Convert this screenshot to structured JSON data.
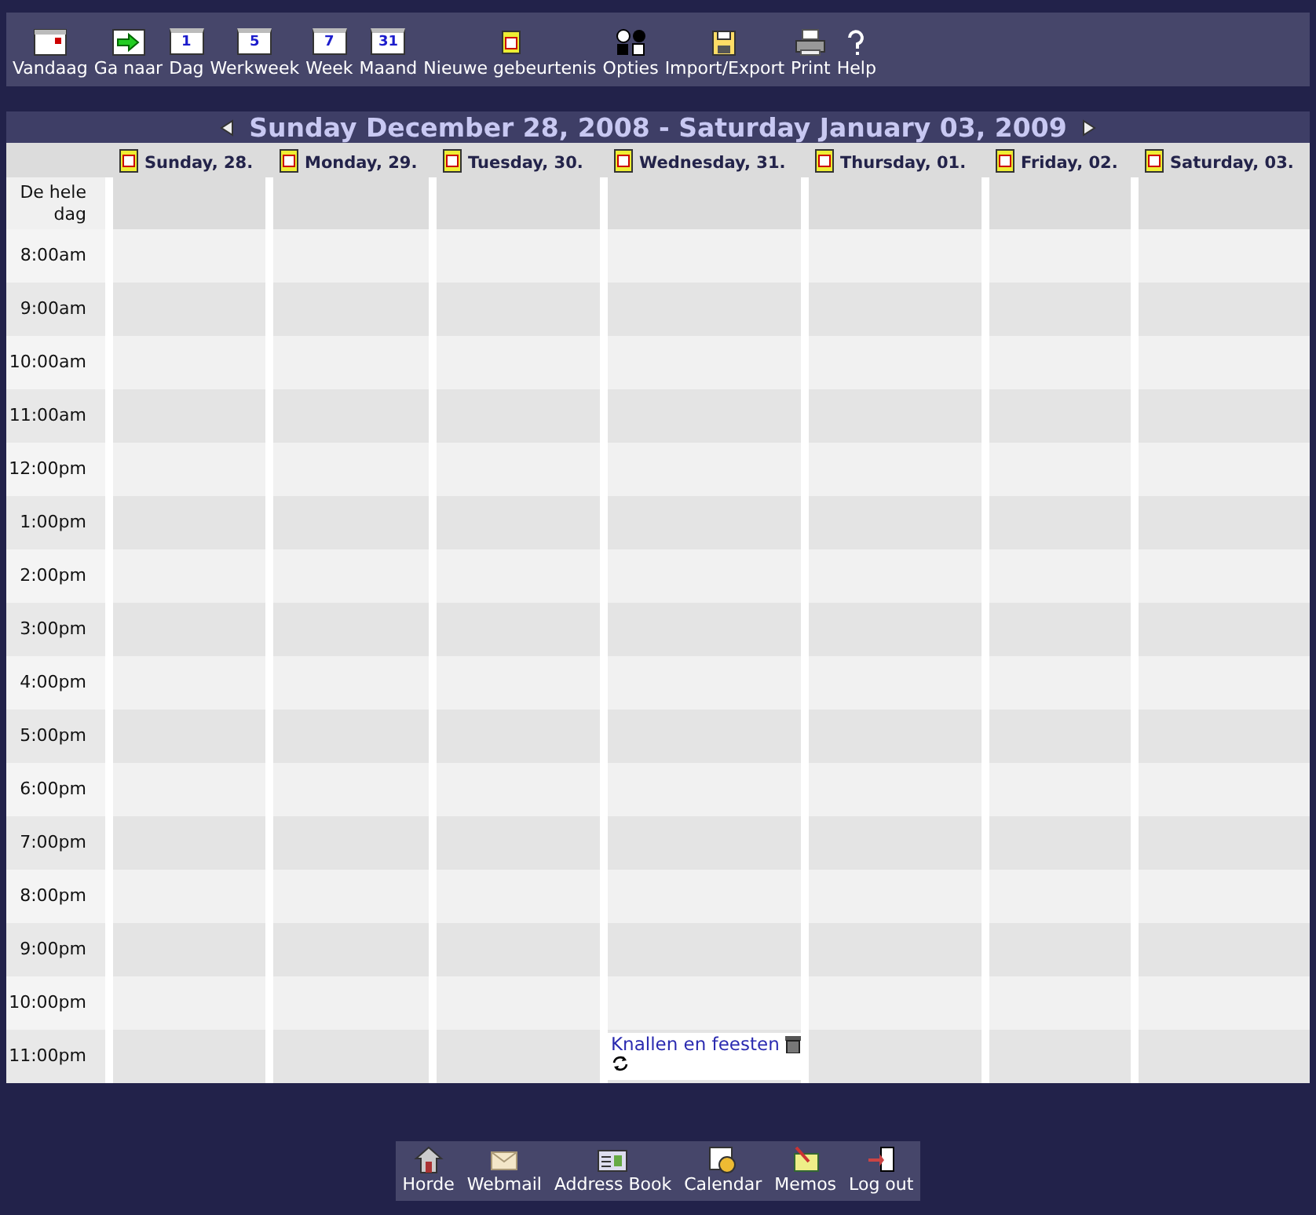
{
  "toolbar": [
    {
      "label": "Vandaag"
    },
    {
      "label": "Ga naar"
    },
    {
      "label": "Dag",
      "icon_text": "1"
    },
    {
      "label": "Werkweek",
      "icon_text": "5"
    },
    {
      "label": "Week",
      "icon_text": "7"
    },
    {
      "label": "Maand",
      "icon_text": "31"
    },
    {
      "label": "Nieuwe gebeurtenis"
    },
    {
      "label": "Opties"
    },
    {
      "label": "Import/Export"
    },
    {
      "label": "Print"
    },
    {
      "label": "Help"
    }
  ],
  "calendar": {
    "title": "Sunday December 28, 2008 - Saturday January 03, 2009",
    "days": [
      {
        "label": "Sunday, 28."
      },
      {
        "label": "Monday, 29."
      },
      {
        "label": "Tuesday, 30."
      },
      {
        "label": "Wednesday, 31."
      },
      {
        "label": "Thursday, 01."
      },
      {
        "label": "Friday, 02."
      },
      {
        "label": "Saturday, 03."
      }
    ],
    "all_day_label": "De hele dag",
    "rows": [
      {
        "time": "8:00am"
      },
      {
        "time": "9:00am"
      },
      {
        "time": "10:00am"
      },
      {
        "time": "11:00am"
      },
      {
        "time": "12:00pm"
      },
      {
        "time": "1:00pm"
      },
      {
        "time": "2:00pm"
      },
      {
        "time": "3:00pm"
      },
      {
        "time": "4:00pm"
      },
      {
        "time": "5:00pm"
      },
      {
        "time": "6:00pm"
      },
      {
        "time": "7:00pm"
      },
      {
        "time": "8:00pm"
      },
      {
        "time": "9:00pm"
      },
      {
        "time": "10:00pm"
      },
      {
        "time": "11:00pm",
        "cells": [
          {},
          {},
          {},
          {
            "events": [
              {
                "title": "Knallen en feesten",
                "recurring": true
              }
            ]
          },
          {},
          {},
          {}
        ]
      }
    ]
  },
  "bottom_nav": [
    {
      "label": "Horde"
    },
    {
      "label": "Webmail"
    },
    {
      "label": "Address Book"
    },
    {
      "label": "Calendar"
    },
    {
      "label": "Memos"
    },
    {
      "label": "Log out"
    }
  ]
}
